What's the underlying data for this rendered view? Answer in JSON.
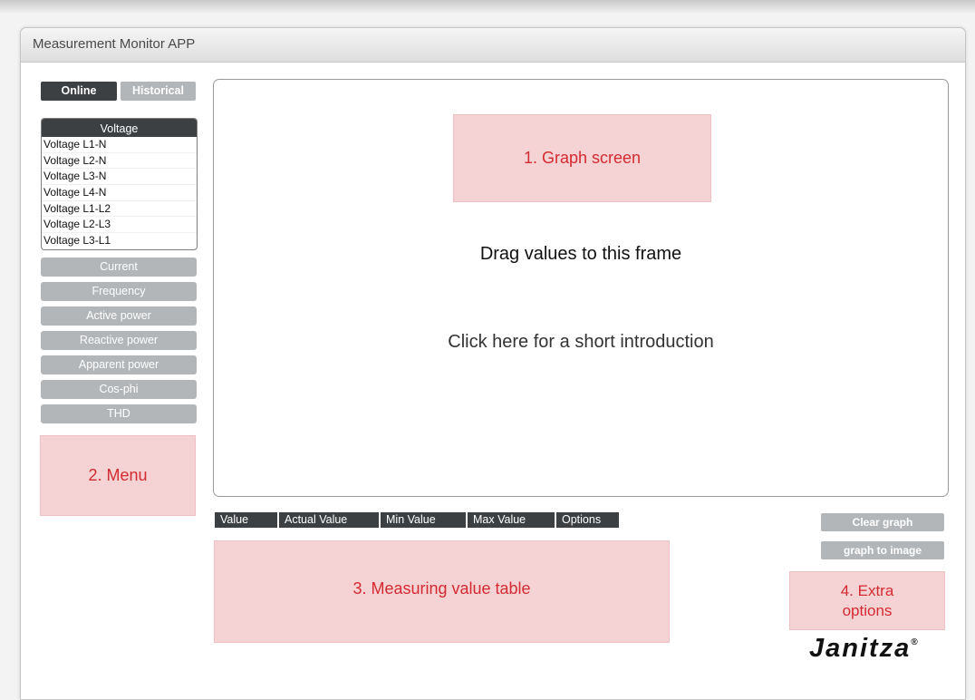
{
  "window": {
    "title": "Measurement Monitor APP"
  },
  "mode_tabs": {
    "online": "Online",
    "historical": "Historical"
  },
  "menu": {
    "voltage": {
      "label": "Voltage",
      "items": [
        "Voltage L1-N",
        "Voltage L2-N",
        "Voltage L3-N",
        "Voltage L4-N",
        "Voltage L1-L2",
        "Voltage L2-L3",
        "Voltage L3-L1"
      ]
    },
    "current": "Current",
    "frequency": "Frequency",
    "active_power": "Active power",
    "reactive_power": "Reactive power",
    "apparent_power": "Apparent power",
    "cos_phi": "Cos-phi",
    "thd": "THD"
  },
  "annotations": {
    "graph_screen": "1. Graph screen",
    "menu": "2. Menu",
    "value_table": "3. Measuring value table",
    "extra_options_line1": "4. Extra",
    "extra_options_line2": "options"
  },
  "graph": {
    "drag_hint": "Drag values to this frame",
    "intro_link": "Click here for a short introduction"
  },
  "table": {
    "columns": [
      "Value",
      "Actual Value",
      "Min Value",
      "Max Value",
      "Options"
    ]
  },
  "extra": {
    "clear_graph": "Clear graph",
    "graph_to_image": "graph to image"
  },
  "brand": {
    "name": "Janitza",
    "mark": "®"
  },
  "colors": {
    "dark_tab": "#3d4043",
    "inactive": "#b3b6b9",
    "annotation_bg": "#f5d3d5",
    "annotation_text": "#d42a31"
  }
}
